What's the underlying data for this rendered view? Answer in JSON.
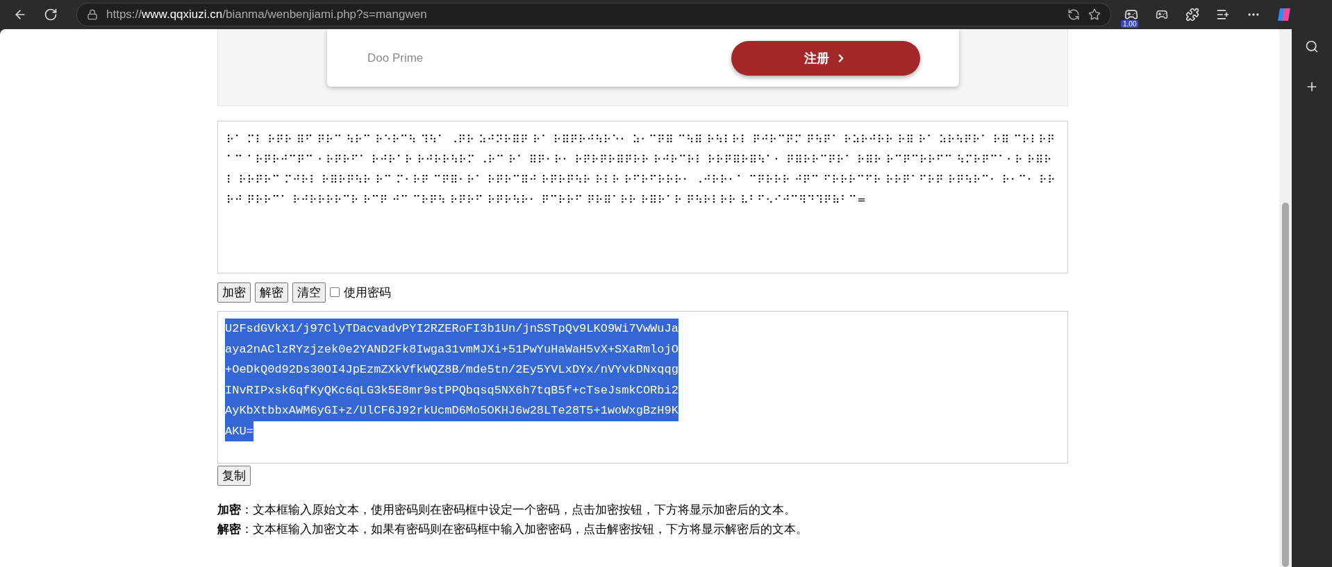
{
  "browser": {
    "url_scheme": "https://",
    "url_domain": "www.qqxiuzi.cn",
    "url_path": "/bianma/wenbenjiami.php?s=mangwen",
    "extension_badge": "1.00"
  },
  "ad": {
    "brand": "Doo Prime",
    "button": "注册"
  },
  "input": {
    "value": "⠗⠁ ⠍⠇ ⠗⠟⠗ ⠿⠋ ⠟⠗⠉ ⠳⠗⠉ ⠗⠑⠗⠉⠳ ⠹⠳⠁ ⠠⠟⠗ ⠵⠚⠝⠗⠿⠟ ⠗⠁ ⠗⠿⠟⠗⠚⠳⠗⠑⠂ ⠵⠂⠉⠟⠿ ⠉⠳⠿ ⠗⠳⠇⠗⠇ ⠟⠚⠗⠉⠟⠍ ⠟⠳⠟⠁ ⠗⠵⠗⠚⠗⠗ ⠗⠿ ⠗⠁ ⠵⠗⠳⠟⠗⠁ ⠗⠿ ⠉⠗⠇⠗⠟⠁⠉ ⠁⠗⠟⠗⠚⠉⠟⠉ ⠂⠗⠟⠗⠋⠁ ⠗⠚⠗⠁⠗ ⠗⠚⠗⠗⠳⠗⠍ ⠠⠗⠉ ⠗⠁ ⠿⠟⠂⠗⠂ ⠗⠟⠗⠟⠗⠿⠟⠗⠗ ⠗⠚⠗⠉⠗⠇ ⠗⠗⠟⠿⠗⠿⠳⠁⠂ ⠟⠿⠗⠗⠉⠟⠗⠁ ⠗⠿⠗ ⠗⠉⠟⠉⠗⠗⠋⠉ ⠳⠍⠗⠟⠉⠁⠂⠗ ⠗⠿⠗⠇ ⠗⠗⠟⠗⠉ ⠍⠚⠗⠇ ⠗⠿⠗⠟⠳⠗ ⠗⠉ ⠍⠂⠗⠟ ⠉⠟⠿⠂⠗⠁ ⠗⠟⠗⠉⠿⠚ ⠗⠟⠗⠟⠳⠗ ⠗⠇⠗ ⠗⠋⠗⠋⠗⠗⠗⠂ ⠠⠚⠗⠗⠂⠁ ⠉⠟⠗⠗⠗ ⠚⠟⠉ ⠋⠗⠗⠗⠉⠋⠗ ⠗⠗⠟⠁⠋⠗⠟ ⠗⠟⠳⠗⠉⠂ ⠗⠂⠉⠂ ⠗⠗⠗⠚ ⠟⠗⠗⠉⠁ ⠗⠚⠗⠗⠗⠗⠉⠗ ⠗⠉⠟ ⠚⠉ ⠉⠗⠟⠳ ⠗⠟⠗⠋ ⠗⠟⠗⠳⠗⠂ ⠟⠉⠗⠗⠋ ⠟⠗⠿⠁⠗⠗ ⠗⠿⠗⠁⠗ ⠟⠳⠗⠇⠗⠗ ⠧⠃⠋⠢⠊⠚⠉⠻⠙⠹⠟⠷⠃⠉="
  },
  "controls": [
    {
      "kind": "button",
      "label": "加密"
    },
    {
      "kind": "button",
      "label": "解密"
    },
    {
      "kind": "button",
      "label": "清空"
    },
    {
      "kind": "checkbox",
      "label": "使用密码",
      "checked": false
    }
  ],
  "output": {
    "lines": [
      "U2FsdGVkX1/j97ClyTDacvadvPYI2RZERoFI3b1Un/jnSSTpQv9LKO9Wi7VwWuJa",
      "aya2nAClzRYzjzek0e2YAND2Fk8Iwga31vmMJXi+51PwYuHaWaH5vX+SXaRmlojO",
      "+OeDkQ0d92Ds30OI4JpEzmZXkVfkWQZ8B/mde5tn/2Ey5YVLxDYx/nVYvkDNxqqg",
      "INvRIPxsk6qfKyQKc6qLG3k5E8mr9stPPQbqsq5NX6h7tqB5f+cTseJsmkCORbi2",
      "AyKbXtbbxAWM6yGI+z/UlCF6J92rkUcmD6Mo5OKHJ6w28LTe28T5+1woWxgBzH9K",
      "AKU="
    ],
    "selected": true
  },
  "copy_button": "复制",
  "help": [
    {
      "term": "加密",
      "text": "：文本框输入原始文本，使用密码则在密码框中设定一个密码，点击加密按钮，下方将显示加密后的文本。"
    },
    {
      "term": "解密",
      "text": "：文本框输入加密文本，如果有密码则在密码框中输入加密密码，点击解密按钮，下方将显示解密后的文本。"
    }
  ]
}
